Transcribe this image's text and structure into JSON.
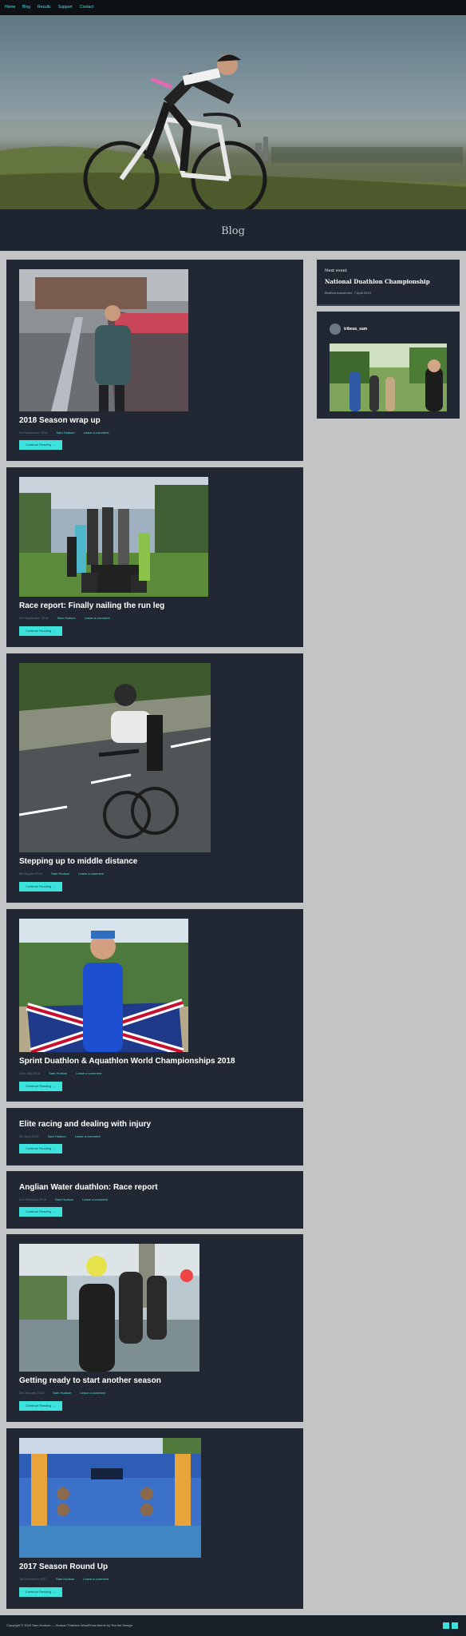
{
  "nav": {
    "items": [
      "Home",
      "Blog",
      "Results",
      "Support",
      "Contact"
    ]
  },
  "page": {
    "title": "Blog"
  },
  "posts": [
    {
      "title": "2018 Season wrap up",
      "date": "3rd November 2018",
      "author": "Sam Hudson",
      "comments": "Leave a comment",
      "cta": "Continue Reading →"
    },
    {
      "title": "Race report: Finally nailing the run leg",
      "date": "3rd September 2018",
      "author": "Sam Hudson",
      "comments": "Leave a comment",
      "cta": "Continue Reading →"
    },
    {
      "title": "Stepping up to middle distance",
      "date": "8th August 2018",
      "author": "Sam Hudson",
      "comments": "Leave a comment",
      "cta": "Continue Reading →"
    },
    {
      "title": "Sprint Duathlon & Aquathlon World Championships 2018",
      "date": "10th July 2018",
      "author": "Sam Hudson",
      "comments": "Leave a comment",
      "cta": "Continue Reading →"
    },
    {
      "title": "Elite racing and dealing with injury",
      "date": "5th April 2018",
      "author": "Sam Hudson",
      "comments": "Leave a comment",
      "cta": "Continue Reading →"
    },
    {
      "title": "Anglian Water duathlon: Race report",
      "date": "2nd February 2018",
      "author": "Sam Hudson",
      "comments": "Leave a comment",
      "cta": "Continue Reading →"
    },
    {
      "title": "Getting ready to start another season",
      "date": "3rd January 2018",
      "author": "Sam Hudson",
      "comments": "Leave a comment",
      "cta": "Continue Reading →"
    },
    {
      "title": "2017 Season Round Up",
      "date": "1st December 2017",
      "author": "Sam Hudson",
      "comments": "Leave a comment",
      "cta": "Continue Reading →"
    }
  ],
  "sidebar": {
    "next_event": {
      "heading": "Next event",
      "name": "National Duathlon Championship",
      "details": "Bedford Autodrome, 7 April 2019"
    },
    "instagram": {
      "username": "tribeas_sam"
    }
  },
  "footer": {
    "copyright": "Copyright © 2019 Sam Hudson — Hudson Triathlon WordPress theme by Tea the Design"
  },
  "colors": {
    "accent": "#3be3dc",
    "panel": "#222833",
    "background": "#c3c4c6"
  }
}
